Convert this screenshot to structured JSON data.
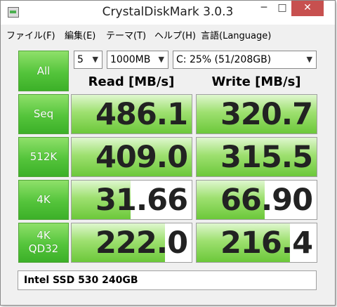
{
  "window": {
    "title": "CrystalDiskMark 3.0.3",
    "controls": {
      "minimize": "─",
      "maximize": "□",
      "close": "✕"
    }
  },
  "menu": [
    {
      "label": "ファイル(F)"
    },
    {
      "label": "編集(E)"
    },
    {
      "label": "テーマ(T)"
    },
    {
      "label": "ヘルプ(H)"
    },
    {
      "label": "言語(Language)"
    }
  ],
  "controls": {
    "all_button": "All",
    "runs": "5",
    "size": "1000MB",
    "drive": "C: 25% (51/208GB)",
    "arrow": "▼"
  },
  "headers": {
    "read": "Read [MB/s]",
    "write": "Write [MB/s]"
  },
  "tests": [
    {
      "label": "Seq",
      "read": "486.1",
      "write": "320.7"
    },
    {
      "label": "512K",
      "read": "409.0",
      "write": "315.5"
    },
    {
      "label": "4K",
      "read": "31.66",
      "write": "66.90"
    },
    {
      "label": "4K\nQD32",
      "label_line1": "4K",
      "label_line2": "QD32",
      "read": "222.0",
      "write": "216.4"
    }
  ],
  "comment": "Intel SSD 530 240GB",
  "colors": {
    "button_green": "#54c43b",
    "bar_green": "#9ee070",
    "close_red": "#c7504f"
  }
}
